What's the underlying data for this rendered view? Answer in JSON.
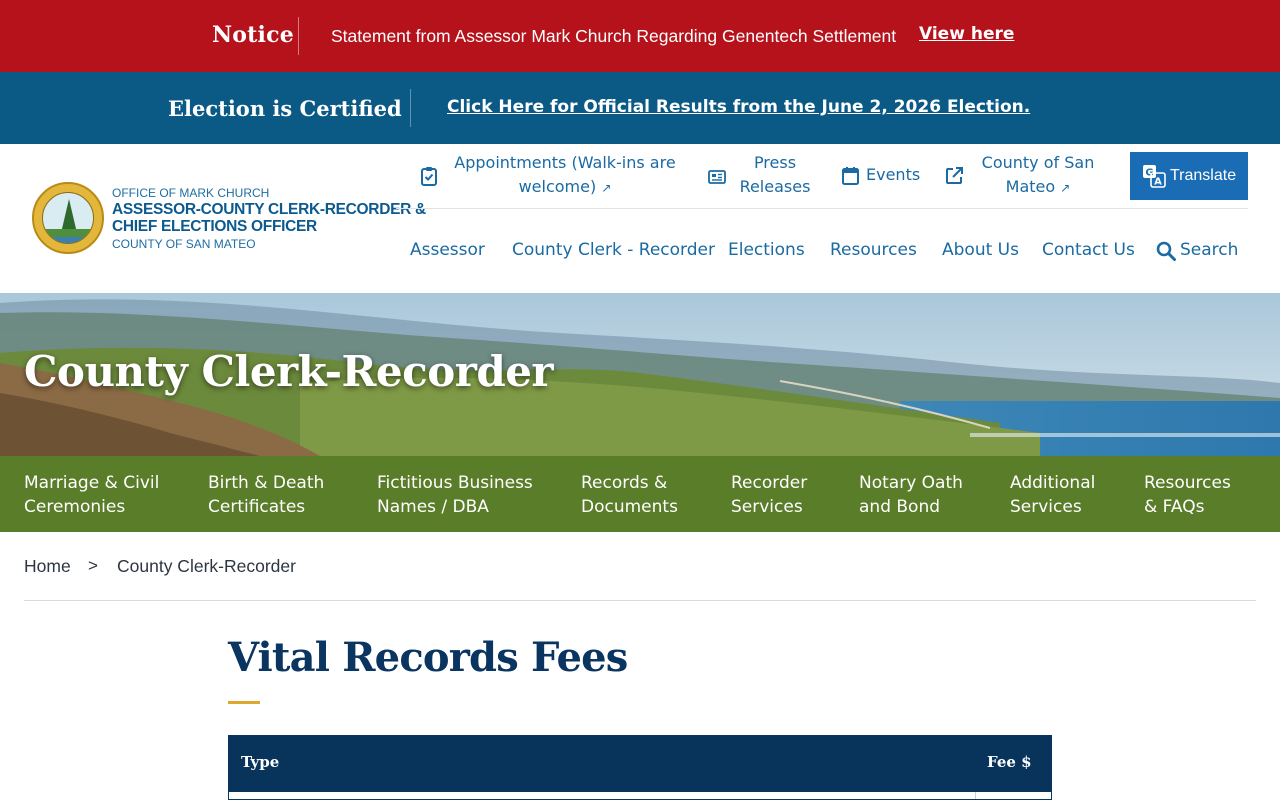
{
  "notice": {
    "label": "Notice",
    "text": "Statement from Assessor Mark Church Regarding Genentech Settlement",
    "link": "View here"
  },
  "election": {
    "label": "Election is Certified",
    "link": "Click Here for Official Results from the June 2, 2026 Election."
  },
  "office": {
    "line1": "OFFICE OF MARK CHURCH",
    "line2": "ASSESSOR-COUNTY CLERK-RECORDER &",
    "line3": "CHIEF ELECTIONS OFFICER",
    "line4": "COUNTY OF SAN MATEO"
  },
  "utility_nav": {
    "appointments_line1": "Appointments (Walk-ins are",
    "appointments_line2": "welcome)",
    "press_line1": "Press",
    "press_line2": "Releases",
    "events": "Events",
    "county_line1": "County of San",
    "county_line2": "Mateo",
    "translate": "Translate"
  },
  "main_nav": {
    "assessor": "Assessor",
    "county_clerk": "County Clerk - Recorder",
    "elections": "Elections",
    "resources": "Resources",
    "about": "About Us",
    "contact": "Contact Us",
    "search": "Search"
  },
  "hero": {
    "title": "County Clerk-Recorder"
  },
  "subnav": [
    {
      "line1": "Marriage & Civil",
      "line2": "Ceremonies"
    },
    {
      "line1": "Birth & Death",
      "line2": "Certificates"
    },
    {
      "line1": "Fictitious Business",
      "line2": "Names / DBA"
    },
    {
      "line1": "Records &",
      "line2": "Documents"
    },
    {
      "line1": "Recorder",
      "line2": "Services"
    },
    {
      "line1": "Notary Oath",
      "line2": "and Bond"
    },
    {
      "line1": "Additional",
      "line2": "Services"
    },
    {
      "line1": "Resources",
      "line2": "& FAQs"
    }
  ],
  "breadcrumb": {
    "home": "Home",
    "separator": ">",
    "current": "County Clerk-Recorder"
  },
  "content": {
    "title": "Vital Records Fees",
    "table_headers": {
      "type": "Type",
      "fee": "Fee $"
    }
  },
  "colors": {
    "notice_bg": "#b5121b",
    "election_bg": "#0b5a86",
    "link_blue": "#1a6aa3",
    "subnav_green": "#5a7d2a",
    "title_navy": "#0b3561",
    "accent_gold": "#e0a72e"
  },
  "icons": {
    "appointments": "clipboard-check-icon",
    "press": "newspaper-icon",
    "events": "calendar-icon",
    "county": "external-link-icon",
    "translate": "translate-icon",
    "search": "search-icon"
  }
}
